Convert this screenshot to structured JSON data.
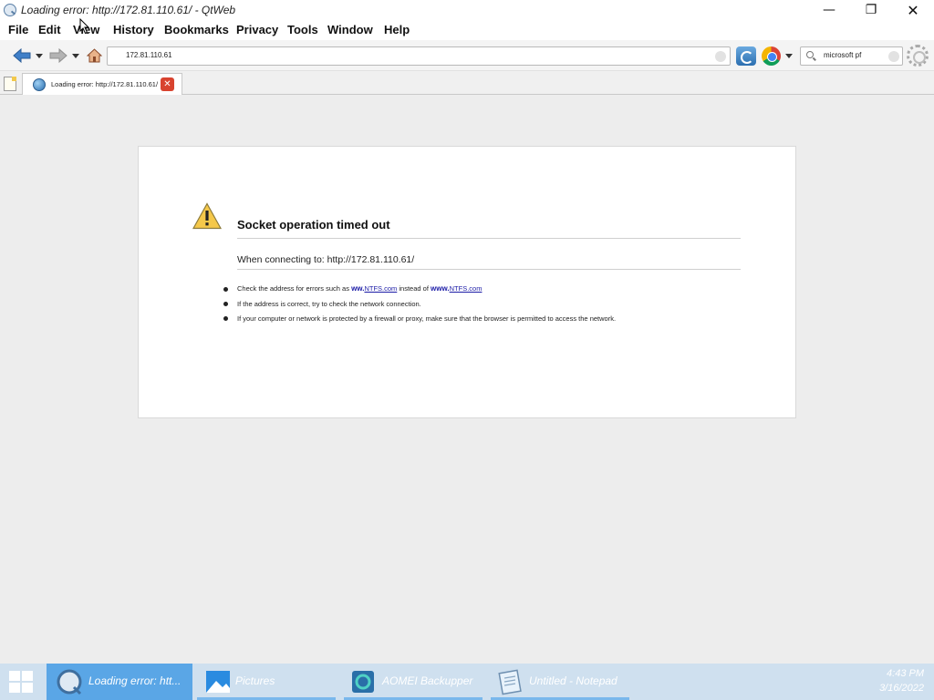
{
  "window": {
    "title": "Loading error: http://172.81.110.61/ - QtWeb",
    "controls": {
      "minimize": "—",
      "maximize": "❐",
      "close": "✕"
    }
  },
  "menu": {
    "items": [
      {
        "label": "File"
      },
      {
        "label": "Edit"
      },
      {
        "label": "View"
      },
      {
        "label": "History"
      },
      {
        "label": "Bookmarks"
      },
      {
        "label": "Privacy"
      },
      {
        "label": "Tools"
      },
      {
        "label": "Window"
      },
      {
        "label": "Help"
      }
    ]
  },
  "toolbar": {
    "address": "172.81.110.61",
    "search_value": "microsoft pf"
  },
  "tabs": [
    {
      "label": "Loading error: http://172.81.110.61/",
      "active": true,
      "close": "✕"
    }
  ],
  "error": {
    "title": "Socket operation timed out",
    "connecting": "When connecting to: http://172.81.110.61/",
    "tip1": {
      "prefix": "Check the address for errors such as",
      "bad_www": "ww.",
      "bad_link": "NTFS.com",
      "middle": "instead of",
      "good_www": "www.",
      "good_link": "NTFS.com"
    },
    "tip2": "If the address is correct, try to check the network connection.",
    "tip3": "If your computer or network is protected by a firewall or proxy, make sure that the browser is permitted to access the network."
  },
  "taskbar": {
    "items": [
      {
        "label": "Loading error: htt...",
        "icon": "qtweb-icon",
        "active": true
      },
      {
        "label": "Pictures",
        "icon": "pictures-folder-icon",
        "active": false
      },
      {
        "label": "AOMEI Backupper",
        "icon": "aomei-backupper-icon",
        "active": false
      },
      {
        "label": "Untitled - Notepad",
        "icon": "notepad-icon",
        "active": false
      }
    ],
    "time": "4:43 PM",
    "date": "3/16/2022"
  },
  "colors": {
    "taskbar": "#cfe0ef",
    "taskbar_active": "#5aa6e6",
    "link": "#1a1aa6",
    "tab_close": "#d8432f"
  }
}
